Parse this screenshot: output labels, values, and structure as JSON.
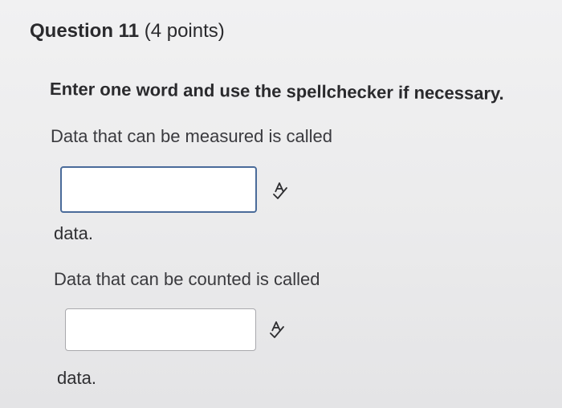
{
  "question": {
    "title": "Question 11",
    "points": "(4 points)"
  },
  "instruction": "Enter one word and use the spellchecker if necessary.",
  "blanks": [
    {
      "prompt": "Data that can be measured is called",
      "value": "",
      "suffix": "data.",
      "spellcheck_icon": "spellcheck-icon"
    },
    {
      "prompt": "Data that can be counted is called",
      "value": "",
      "suffix": "data.",
      "spellcheck_icon": "spellcheck-icon"
    }
  ],
  "colors": {
    "focused_border": "#4a6b9a",
    "default_border": "#a9a9ad",
    "background": "#ececed"
  }
}
